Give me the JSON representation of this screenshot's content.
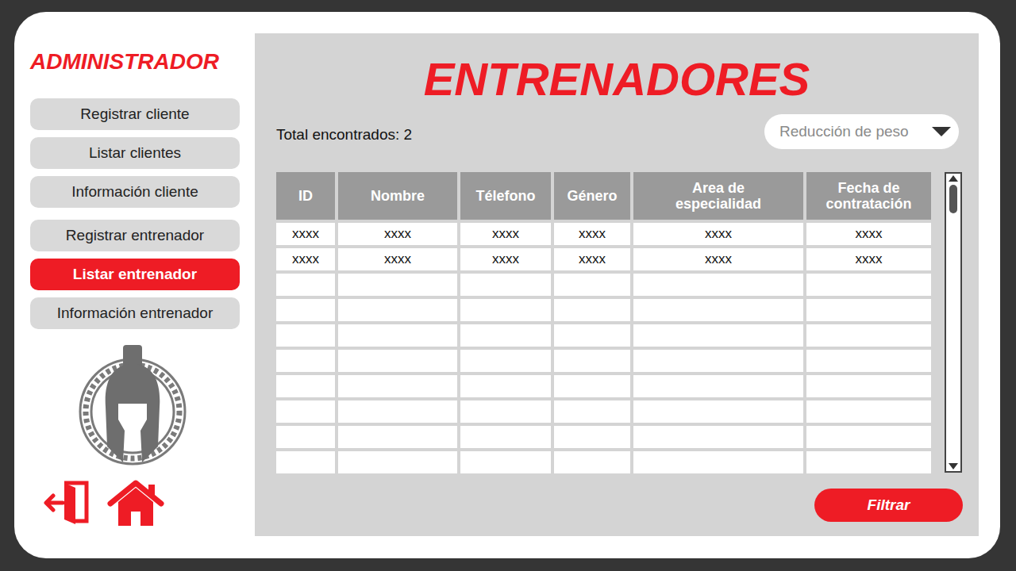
{
  "sidebar": {
    "title": "ADMINISTRADOR",
    "groups": [
      [
        {
          "label": "Registrar cliente",
          "selected": false
        },
        {
          "label": "Listar clientes",
          "selected": false
        },
        {
          "label": "Información cliente",
          "selected": false
        }
      ],
      [
        {
          "label": "Registrar entrenador",
          "selected": false
        },
        {
          "label": "Listar entrenador",
          "selected": true
        },
        {
          "label": "Información entrenador",
          "selected": false
        }
      ]
    ]
  },
  "page": {
    "title": "ENTRENADORES",
    "total": "Total encontrados: 2"
  },
  "filter": {
    "placeholder": "Reducción de peso",
    "button": "Filtrar"
  },
  "table": {
    "columns": [
      "ID",
      "Nombre",
      "Télefono",
      "Género",
      "Area de especialidad",
      "Fecha de contratación"
    ],
    "rows": [
      [
        "xxxx",
        "xxxx",
        "xxxx",
        "xxxx",
        "xxxx",
        "xxxx"
      ],
      [
        "xxxx",
        "xxxx",
        "xxxx",
        "xxxx",
        "xxxx",
        "xxxx"
      ],
      [
        "",
        "",
        "",
        "",
        "",
        ""
      ],
      [
        "",
        "",
        "",
        "",
        "",
        ""
      ],
      [
        "",
        "",
        "",
        "",
        "",
        ""
      ],
      [
        "",
        "",
        "",
        "",
        "",
        ""
      ],
      [
        "",
        "",
        "",
        "",
        "",
        ""
      ],
      [
        "",
        "",
        "",
        "",
        "",
        ""
      ],
      [
        "",
        "",
        "",
        "",
        "",
        ""
      ],
      [
        "",
        "",
        "",
        "",
        "",
        ""
      ]
    ]
  }
}
